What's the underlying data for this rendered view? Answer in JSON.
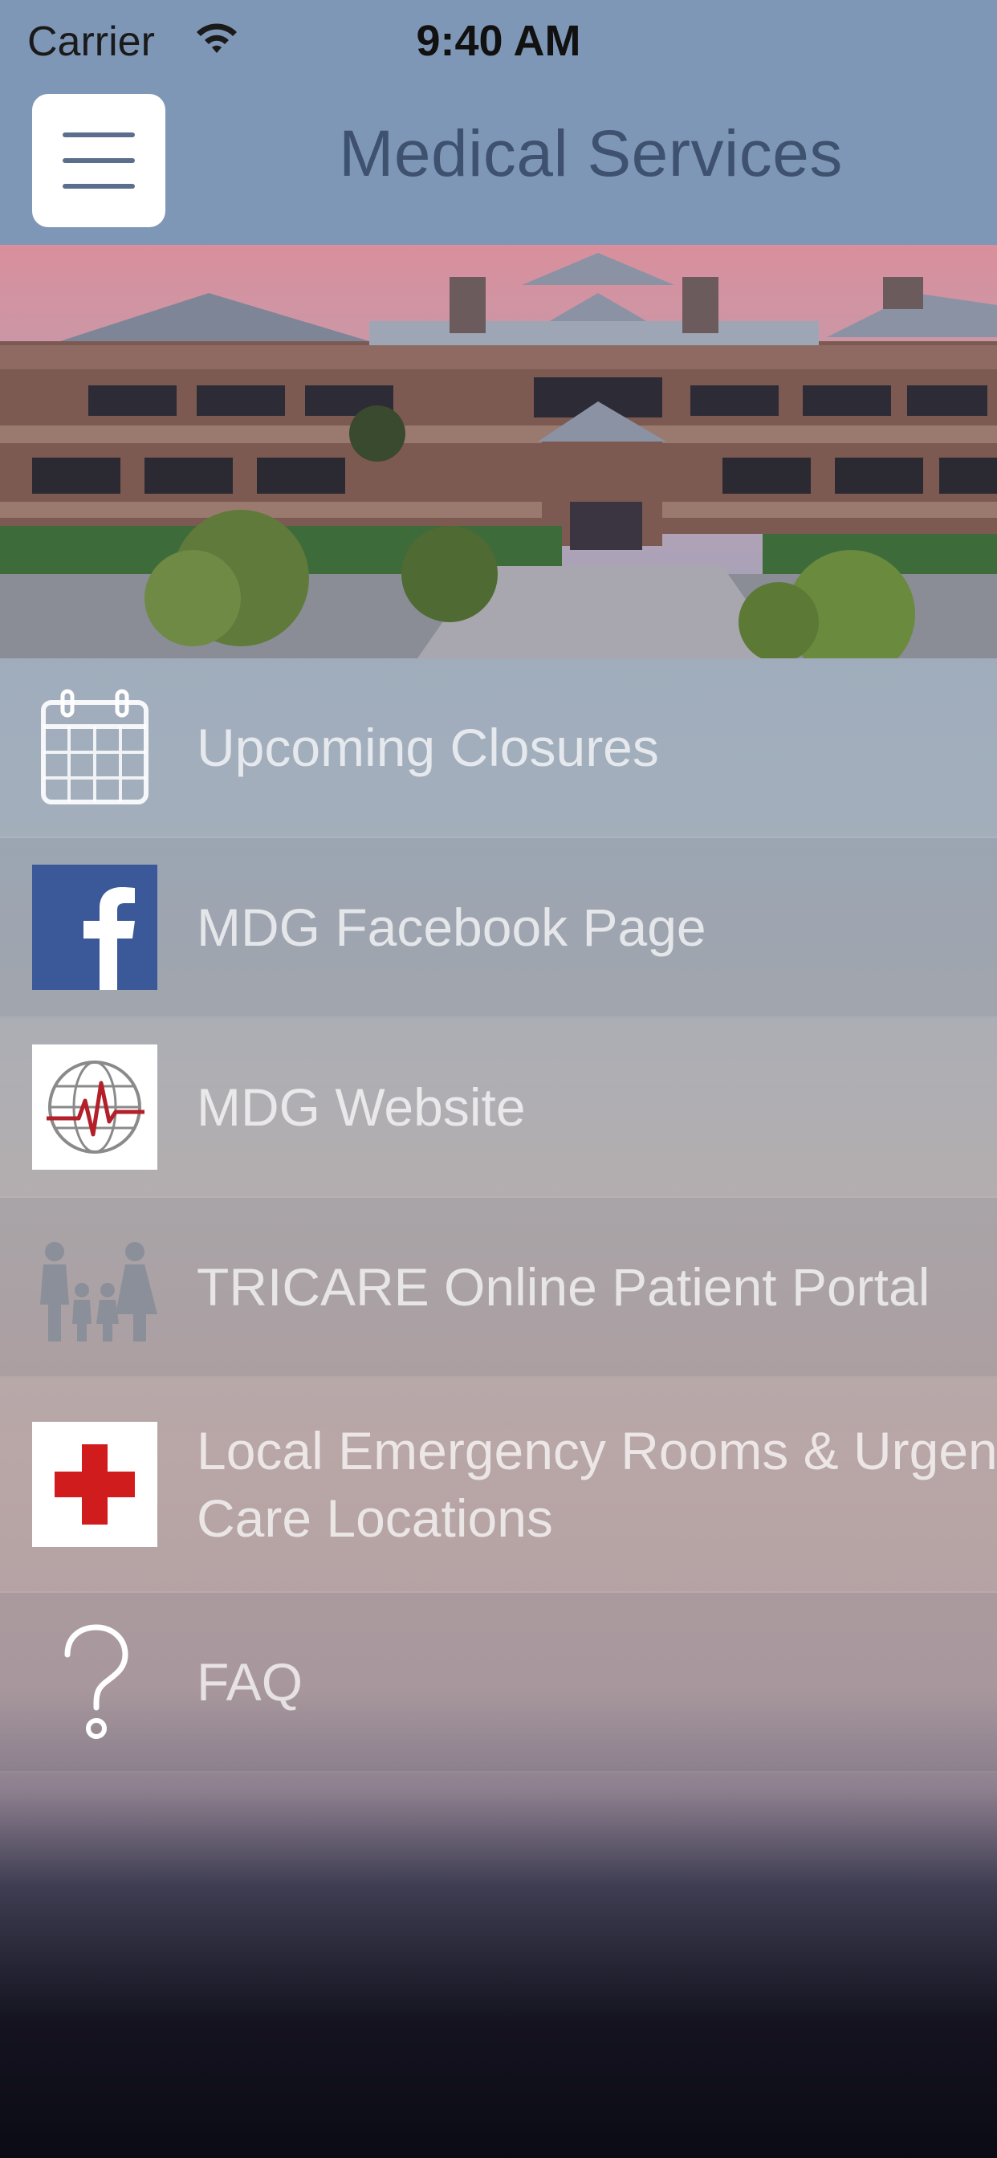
{
  "status_bar": {
    "carrier": "Carrier",
    "time": "9:40 AM",
    "wifi_icon": "wifi-icon"
  },
  "nav": {
    "title": "Medical Services",
    "menu_icon": "hamburger-menu-icon"
  },
  "hero": {
    "image": "medical-building-photo"
  },
  "menu": {
    "items": [
      {
        "label": "Upcoming Closures",
        "icon": "calendar-icon"
      },
      {
        "label": "MDG Facebook Page",
        "icon": "facebook-icon"
      },
      {
        "label": "MDG Website",
        "icon": "globe-heartbeat-logo-icon"
      },
      {
        "label": "TRICARE Online Patient Portal",
        "icon": "family-icon"
      },
      {
        "label": "Local Emergency Rooms & Urgent Care Locations",
        "icon": "red-cross-icon"
      },
      {
        "label": "FAQ",
        "icon": "question-mark-icon"
      }
    ]
  },
  "colors": {
    "bar": "#7f97b6",
    "title": "#3e5270",
    "facebook": "#3b5998",
    "cross": "#d01c1c"
  }
}
